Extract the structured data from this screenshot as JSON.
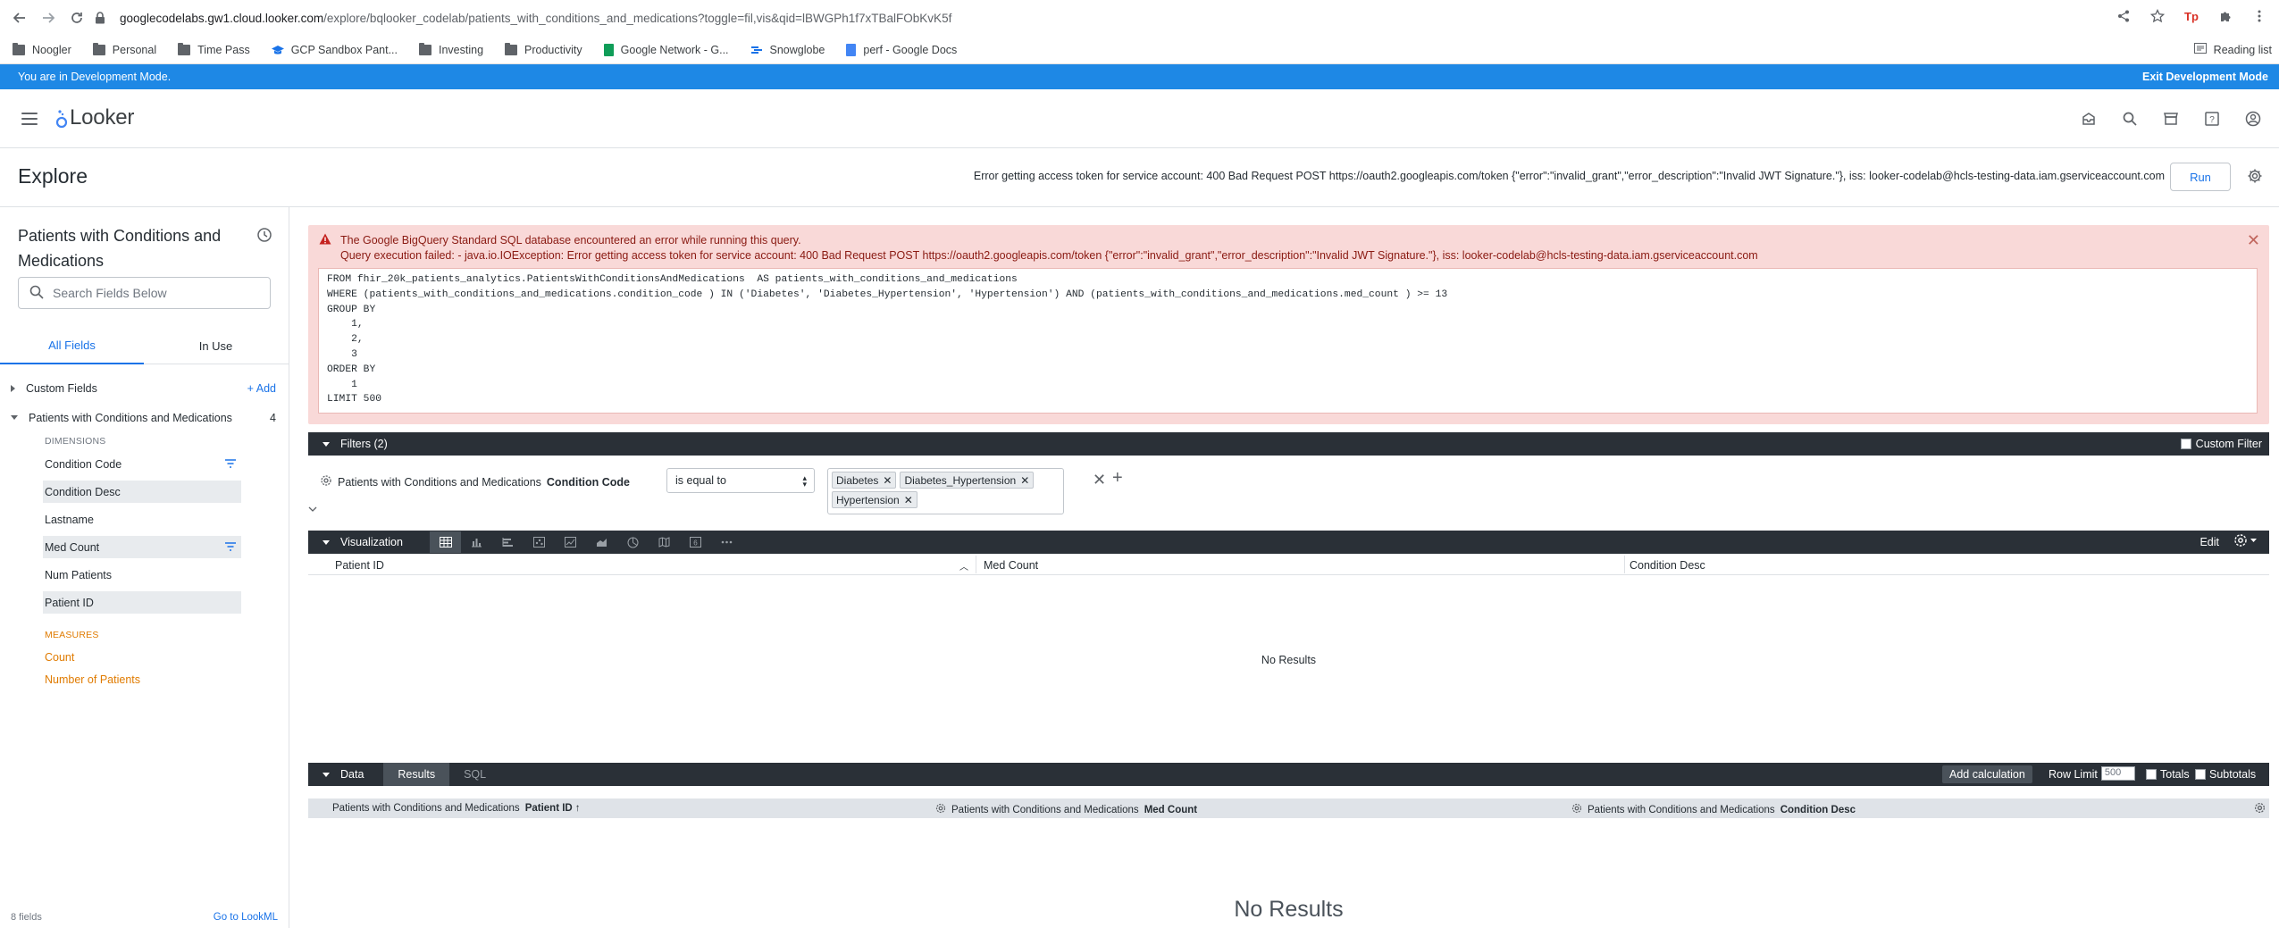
{
  "browser": {
    "url_host": "googlecodelabs.gw1.cloud.looker.com",
    "url_path": "/explore/bqlooker_codelab/patients_with_conditions_and_medications?toggle=fil,vis&qid=lBWGPh1f7xTBalFObKvK5f",
    "bookmarks": [
      "Noogler",
      "Personal",
      "Time Pass",
      "GCP Sandbox Pant...",
      "Investing",
      "Productivity",
      "Google Network - G...",
      "Snowglobe",
      "perf - Google Docs"
    ],
    "reading_list": "Reading list"
  },
  "devbar": {
    "message_prefix": "You are in ",
    "message_strong": "Development Mode.",
    "exit_label": "Exit Development Mode"
  },
  "header": {
    "logo_text": "Looker"
  },
  "explore": {
    "title": "Explore",
    "header_error": "Error getting access token for service account: 400 Bad Request POST https://oauth2.googleapis.com/token {\"error\":\"invalid_grant\",\"error_description\":\"Invalid JWT Signature.\"}, iss: looker-codelab@hcls-testing-data.iam.gserviceaccount.com",
    "run_label": "Run"
  },
  "left_panel": {
    "title": "Patients with Conditions and Medications",
    "search_placeholder": "Search Fields Below",
    "tabs": [
      "All Fields",
      "In Use"
    ],
    "custom_fields": "Custom Fields",
    "add_label": "+ Add",
    "view_name": "Patients with Conditions and Medications",
    "view_count": "4",
    "dimensions_label": "DIMENSIONS",
    "dimensions": [
      "Condition Code",
      "Condition Desc",
      "Lastname",
      "Med Count",
      "Num Patients",
      "Patient ID"
    ],
    "measures_label": "MEASURES",
    "measures": [
      "Count",
      "Number of Patients"
    ],
    "footer_fields": "8 fields",
    "footer_link": "Go to LookML"
  },
  "error": {
    "title": "The Google BigQuery Standard SQL database encountered an error while running this query.",
    "detail": "Query execution failed: - java.io.IOException: Error getting access token for service account: 400 Bad Request POST https://oauth2.googleapis.com/token {\"error\":\"invalid_grant\",\"error_description\":\"Invalid JWT Signature.\"}, iss: looker-codelab@hcls-testing-data.iam.gserviceaccount.com",
    "sql": "FROM fhir_20k_patients_analytics.PatientsWithConditionsAndMedications  AS patients_with_conditions_and_medications\nWHERE (patients_with_conditions_and_medications.condition_code ) IN ('Diabetes', 'Diabetes_Hypertension', 'Hypertension') AND (patients_with_conditions_and_medications.med_count ) >= 13\nGROUP BY\n    1,\n    2,\n    3\nORDER BY\n    1\nLIMIT 500"
  },
  "filters": {
    "bar_label": "Filters (2)",
    "custom_filter": "Custom Filter",
    "field_view": "Patients with Conditions and Medications",
    "field_name": "Condition Code",
    "operator": "is equal to",
    "values": [
      "Diabetes",
      "Diabetes_Hypertension",
      "Hypertension"
    ]
  },
  "visualization": {
    "bar_label": "Visualization",
    "edit_label": "Edit",
    "columns": [
      "Patient ID",
      "Med Count",
      "Condition Desc"
    ],
    "no_results": "No Results"
  },
  "data": {
    "bar_label": "Data",
    "tabs": [
      "Results",
      "SQL"
    ],
    "add_calc": "Add calculation",
    "row_limit_label": "Row Limit",
    "row_limit_value": "500",
    "totals": "Totals",
    "subtotals": "Subtotals",
    "columns": [
      {
        "view": "Patients with Conditions and Medications",
        "field": "Patient ID",
        "sort": "↑"
      },
      {
        "view": "Patients with Conditions and Medications",
        "field": "Med Count"
      },
      {
        "view": "Patients with Conditions and Medications",
        "field": "Condition Desc"
      }
    ],
    "no_results": "No Results"
  }
}
